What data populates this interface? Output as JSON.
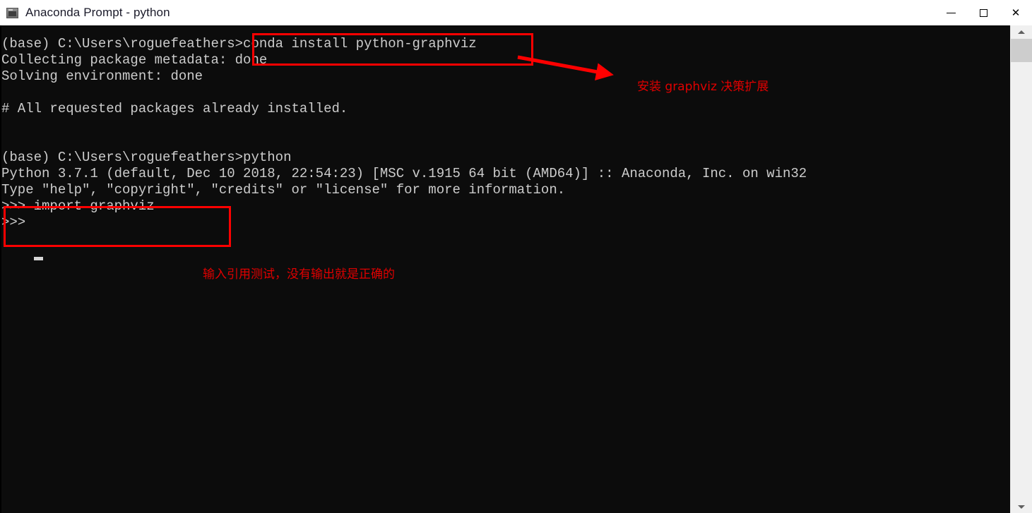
{
  "window": {
    "title": "Anaconda Prompt - python",
    "icon": "console-window-icon",
    "controls": {
      "minimize_label": "—",
      "maximize_label": "□",
      "close_label": "✕"
    }
  },
  "theme": {
    "titlebar_bg": "#ffffff",
    "titlebar_fg": "#1b1b2a",
    "terminal_bg": "#0c0c0c",
    "terminal_fg": "#cccccc",
    "annotation_color": "#ff0000",
    "annotation_text_color": "#e00000",
    "scrollbar_track": "#f0f0f0",
    "scrollbar_thumb": "#cdcdcd"
  },
  "terminal": {
    "lines": [
      "(base) C:\\Users\\roguefeathers>conda install python-graphviz",
      "Collecting package metadata: done",
      "Solving environment: done",
      "",
      "# All requested packages already installed.",
      "",
      "",
      "(base) C:\\Users\\roguefeathers>python",
      "Python 3.7.1 (default, Dec 10 2018, 22:54:23) [MSC v.1915 64 bit (AMD64)] :: Anaconda, Inc. on win32",
      "Type \"help\", \"copyright\", \"credits\" or \"license\" for more information.",
      ">>> import graphviz",
      ">>> "
    ],
    "cursor": {
      "visible": true,
      "row": 12,
      "column": 5
    }
  },
  "annotations": [
    {
      "id": "highlight-conda-install-command",
      "kind": "rectangle",
      "target_text": "conda install python-graphviz"
    },
    {
      "id": "highlight-import-graphviz",
      "kind": "rectangle",
      "target_text": ">>> import graphviz"
    },
    {
      "id": "callout-install-graphviz",
      "kind": "arrow-label",
      "text": "安装 graphviz 决策扩展"
    },
    {
      "id": "callout-import-test",
      "kind": "label",
      "text": "输入引用测试，没有输出就是正确的"
    }
  ],
  "scrollbar": {
    "up_arrow": "chevron-up-icon",
    "down_arrow": "chevron-down-icon",
    "thumb_position_percent": 3
  }
}
